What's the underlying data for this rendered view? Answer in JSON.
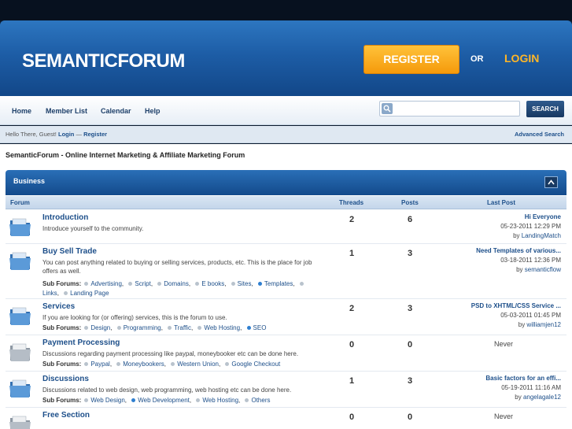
{
  "header": {
    "logo": "SEMANTICFORUM",
    "register_label": "REGISTER",
    "or_label": "OR",
    "login_label": "LOGIN"
  },
  "nav": {
    "items": [
      "Home",
      "Member List",
      "Calendar",
      "Help"
    ],
    "search_placeholder": "",
    "search_button": "SEARCH"
  },
  "welcome": {
    "prefix": "Hello There, Guest! ",
    "login": "Login",
    "separator": " — ",
    "register": "Register",
    "advanced_search": "Advanced Search"
  },
  "page_title": "SemanticForum - Online Internet Marketing & Affiliate Marketing Forum",
  "category": {
    "title": "Business",
    "columns": [
      "Forum",
      "Threads",
      "Posts",
      "Last Post"
    ]
  },
  "forums": [
    {
      "name": "Introduction",
      "description": "Introduce yourself to the community.",
      "subforums_label": "",
      "subforums": [],
      "threads": "2",
      "posts": "6",
      "last_post": {
        "title": "Hi Everyone",
        "date": "05-23-2011 12:29 PM",
        "by_prefix": "by ",
        "author": "LandingMatch"
      },
      "has_new": true
    },
    {
      "name": "Buy Sell Trade",
      "description": "You can post anything related to buying or selling services, products, etc. This is the place for job offers as well.",
      "subforums_label": "Sub Forums:",
      "subforums": [
        {
          "name": "Advertising",
          "new": false
        },
        {
          "name": "Script",
          "new": false
        },
        {
          "name": "Domains",
          "new": false
        },
        {
          "name": "E books",
          "new": false
        },
        {
          "name": "Sites",
          "new": false
        },
        {
          "name": "Templates",
          "new": true
        },
        {
          "name": "Links",
          "new": false
        },
        {
          "name": "Landing Page",
          "new": false
        }
      ],
      "threads": "1",
      "posts": "3",
      "last_post": {
        "title": "Need Templates of various...",
        "date": "03-18-2011 12:36 PM",
        "by_prefix": "by ",
        "author": "semanticflow"
      },
      "has_new": true
    },
    {
      "name": "Services",
      "description": "If you are looking for (or offering) services, this is the forum to use.",
      "subforums_label": "Sub Forums:",
      "subforums": [
        {
          "name": "Design",
          "new": false
        },
        {
          "name": "Programming",
          "new": false
        },
        {
          "name": "Traffic",
          "new": false
        },
        {
          "name": "Web Hosting",
          "new": false
        },
        {
          "name": "SEO",
          "new": true
        }
      ],
      "threads": "2",
      "posts": "3",
      "last_post": {
        "title": "PSD to XHTML/CSS Service ...",
        "date": "05-03-2011 01:45 PM",
        "by_prefix": "by ",
        "author": "williamjen12"
      },
      "has_new": true
    },
    {
      "name": "Payment Processing",
      "description": "Discussions regarding payment processing like paypal, moneybooker etc can be done here.",
      "subforums_label": "Sub Forums:",
      "subforums": [
        {
          "name": "Paypal",
          "new": false
        },
        {
          "name": "Moneybookers",
          "new": false
        },
        {
          "name": "Western Union",
          "new": false
        },
        {
          "name": "Google Checkout",
          "new": false
        }
      ],
      "threads": "0",
      "posts": "0",
      "last_post": {
        "never": "Never"
      },
      "has_new": false
    },
    {
      "name": "Discussions",
      "description": "Discussions related to web design, web programming, web hosting etc can be done here.",
      "subforums_label": "Sub Forums:",
      "subforums": [
        {
          "name": "Web Design",
          "new": false
        },
        {
          "name": "Web Development",
          "new": true
        },
        {
          "name": "Web Hosting",
          "new": false
        },
        {
          "name": "Others",
          "new": false
        }
      ],
      "threads": "1",
      "posts": "3",
      "last_post": {
        "title": "Basic factors for an effi...",
        "date": "05-19-2011 11:16 AM",
        "by_prefix": "by ",
        "author": "angelagale12"
      },
      "has_new": true
    },
    {
      "name": "Free Section",
      "description": "",
      "subforums_label": "",
      "subforums": [],
      "threads": "0",
      "posts": "0",
      "last_post": {
        "never": "Never"
      },
      "has_new": false
    }
  ]
}
